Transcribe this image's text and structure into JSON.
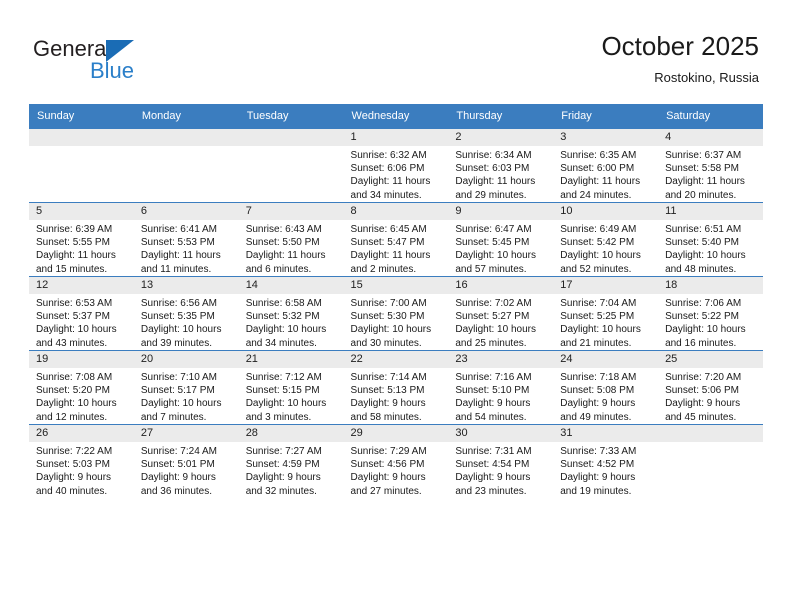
{
  "logo": {
    "word_one": "General",
    "word_two": "Blue",
    "triangle_icon": "blue-triangle-icon",
    "accent_dark": "#231f20",
    "accent_blue": "#2a7fc9"
  },
  "header": {
    "title": "October 2025",
    "subtitle": "Rostokino, Russia"
  },
  "theme": {
    "header_row_bg": "#3b7dbf",
    "cell_head_bg": "#ebebeb",
    "text": "#1a1a1a"
  },
  "weekday_headers": [
    "Sunday",
    "Monday",
    "Tuesday",
    "Wednesday",
    "Thursday",
    "Friday",
    "Saturday"
  ],
  "weeks": [
    [
      {
        "day": "",
        "sunrise": "",
        "sunset": "",
        "daylight_line1": "",
        "daylight_line2": "",
        "empty": true
      },
      {
        "day": "",
        "sunrise": "",
        "sunset": "",
        "daylight_line1": "",
        "daylight_line2": "",
        "empty": true
      },
      {
        "day": "",
        "sunrise": "",
        "sunset": "",
        "daylight_line1": "",
        "daylight_line2": "",
        "empty": true
      },
      {
        "day": "1",
        "sunrise": "Sunrise: 6:32 AM",
        "sunset": "Sunset: 6:06 PM",
        "daylight_line1": "Daylight: 11 hours",
        "daylight_line2": "and 34 minutes.",
        "empty": false
      },
      {
        "day": "2",
        "sunrise": "Sunrise: 6:34 AM",
        "sunset": "Sunset: 6:03 PM",
        "daylight_line1": "Daylight: 11 hours",
        "daylight_line2": "and 29 minutes.",
        "empty": false
      },
      {
        "day": "3",
        "sunrise": "Sunrise: 6:35 AM",
        "sunset": "Sunset: 6:00 PM",
        "daylight_line1": "Daylight: 11 hours",
        "daylight_line2": "and 24 minutes.",
        "empty": false
      },
      {
        "day": "4",
        "sunrise": "Sunrise: 6:37 AM",
        "sunset": "Sunset: 5:58 PM",
        "daylight_line1": "Daylight: 11 hours",
        "daylight_line2": "and 20 minutes.",
        "empty": false
      }
    ],
    [
      {
        "day": "5",
        "sunrise": "Sunrise: 6:39 AM",
        "sunset": "Sunset: 5:55 PM",
        "daylight_line1": "Daylight: 11 hours",
        "daylight_line2": "and 15 minutes.",
        "empty": false
      },
      {
        "day": "6",
        "sunrise": "Sunrise: 6:41 AM",
        "sunset": "Sunset: 5:53 PM",
        "daylight_line1": "Daylight: 11 hours",
        "daylight_line2": "and 11 minutes.",
        "empty": false
      },
      {
        "day": "7",
        "sunrise": "Sunrise: 6:43 AM",
        "sunset": "Sunset: 5:50 PM",
        "daylight_line1": "Daylight: 11 hours",
        "daylight_line2": "and 6 minutes.",
        "empty": false
      },
      {
        "day": "8",
        "sunrise": "Sunrise: 6:45 AM",
        "sunset": "Sunset: 5:47 PM",
        "daylight_line1": "Daylight: 11 hours",
        "daylight_line2": "and 2 minutes.",
        "empty": false
      },
      {
        "day": "9",
        "sunrise": "Sunrise: 6:47 AM",
        "sunset": "Sunset: 5:45 PM",
        "daylight_line1": "Daylight: 10 hours",
        "daylight_line2": "and 57 minutes.",
        "empty": false
      },
      {
        "day": "10",
        "sunrise": "Sunrise: 6:49 AM",
        "sunset": "Sunset: 5:42 PM",
        "daylight_line1": "Daylight: 10 hours",
        "daylight_line2": "and 52 minutes.",
        "empty": false
      },
      {
        "day": "11",
        "sunrise": "Sunrise: 6:51 AM",
        "sunset": "Sunset: 5:40 PM",
        "daylight_line1": "Daylight: 10 hours",
        "daylight_line2": "and 48 minutes.",
        "empty": false
      }
    ],
    [
      {
        "day": "12",
        "sunrise": "Sunrise: 6:53 AM",
        "sunset": "Sunset: 5:37 PM",
        "daylight_line1": "Daylight: 10 hours",
        "daylight_line2": "and 43 minutes.",
        "empty": false
      },
      {
        "day": "13",
        "sunrise": "Sunrise: 6:56 AM",
        "sunset": "Sunset: 5:35 PM",
        "daylight_line1": "Daylight: 10 hours",
        "daylight_line2": "and 39 minutes.",
        "empty": false
      },
      {
        "day": "14",
        "sunrise": "Sunrise: 6:58 AM",
        "sunset": "Sunset: 5:32 PM",
        "daylight_line1": "Daylight: 10 hours",
        "daylight_line2": "and 34 minutes.",
        "empty": false
      },
      {
        "day": "15",
        "sunrise": "Sunrise: 7:00 AM",
        "sunset": "Sunset: 5:30 PM",
        "daylight_line1": "Daylight: 10 hours",
        "daylight_line2": "and 30 minutes.",
        "empty": false
      },
      {
        "day": "16",
        "sunrise": "Sunrise: 7:02 AM",
        "sunset": "Sunset: 5:27 PM",
        "daylight_line1": "Daylight: 10 hours",
        "daylight_line2": "and 25 minutes.",
        "empty": false
      },
      {
        "day": "17",
        "sunrise": "Sunrise: 7:04 AM",
        "sunset": "Sunset: 5:25 PM",
        "daylight_line1": "Daylight: 10 hours",
        "daylight_line2": "and 21 minutes.",
        "empty": false
      },
      {
        "day": "18",
        "sunrise": "Sunrise: 7:06 AM",
        "sunset": "Sunset: 5:22 PM",
        "daylight_line1": "Daylight: 10 hours",
        "daylight_line2": "and 16 minutes.",
        "empty": false
      }
    ],
    [
      {
        "day": "19",
        "sunrise": "Sunrise: 7:08 AM",
        "sunset": "Sunset: 5:20 PM",
        "daylight_line1": "Daylight: 10 hours",
        "daylight_line2": "and 12 minutes.",
        "empty": false
      },
      {
        "day": "20",
        "sunrise": "Sunrise: 7:10 AM",
        "sunset": "Sunset: 5:17 PM",
        "daylight_line1": "Daylight: 10 hours",
        "daylight_line2": "and 7 minutes.",
        "empty": false
      },
      {
        "day": "21",
        "sunrise": "Sunrise: 7:12 AM",
        "sunset": "Sunset: 5:15 PM",
        "daylight_line1": "Daylight: 10 hours",
        "daylight_line2": "and 3 minutes.",
        "empty": false
      },
      {
        "day": "22",
        "sunrise": "Sunrise: 7:14 AM",
        "sunset": "Sunset: 5:13 PM",
        "daylight_line1": "Daylight: 9 hours",
        "daylight_line2": "and 58 minutes.",
        "empty": false
      },
      {
        "day": "23",
        "sunrise": "Sunrise: 7:16 AM",
        "sunset": "Sunset: 5:10 PM",
        "daylight_line1": "Daylight: 9 hours",
        "daylight_line2": "and 54 minutes.",
        "empty": false
      },
      {
        "day": "24",
        "sunrise": "Sunrise: 7:18 AM",
        "sunset": "Sunset: 5:08 PM",
        "daylight_line1": "Daylight: 9 hours",
        "daylight_line2": "and 49 minutes.",
        "empty": false
      },
      {
        "day": "25",
        "sunrise": "Sunrise: 7:20 AM",
        "sunset": "Sunset: 5:06 PM",
        "daylight_line1": "Daylight: 9 hours",
        "daylight_line2": "and 45 minutes.",
        "empty": false
      }
    ],
    [
      {
        "day": "26",
        "sunrise": "Sunrise: 7:22 AM",
        "sunset": "Sunset: 5:03 PM",
        "daylight_line1": "Daylight: 9 hours",
        "daylight_line2": "and 40 minutes.",
        "empty": false
      },
      {
        "day": "27",
        "sunrise": "Sunrise: 7:24 AM",
        "sunset": "Sunset: 5:01 PM",
        "daylight_line1": "Daylight: 9 hours",
        "daylight_line2": "and 36 minutes.",
        "empty": false
      },
      {
        "day": "28",
        "sunrise": "Sunrise: 7:27 AM",
        "sunset": "Sunset: 4:59 PM",
        "daylight_line1": "Daylight: 9 hours",
        "daylight_line2": "and 32 minutes.",
        "empty": false
      },
      {
        "day": "29",
        "sunrise": "Sunrise: 7:29 AM",
        "sunset": "Sunset: 4:56 PM",
        "daylight_line1": "Daylight: 9 hours",
        "daylight_line2": "and 27 minutes.",
        "empty": false
      },
      {
        "day": "30",
        "sunrise": "Sunrise: 7:31 AM",
        "sunset": "Sunset: 4:54 PM",
        "daylight_line1": "Daylight: 9 hours",
        "daylight_line2": "and 23 minutes.",
        "empty": false
      },
      {
        "day": "31",
        "sunrise": "Sunrise: 7:33 AM",
        "sunset": "Sunset: 4:52 PM",
        "daylight_line1": "Daylight: 9 hours",
        "daylight_line2": "and 19 minutes.",
        "empty": false
      },
      {
        "day": "",
        "sunrise": "",
        "sunset": "",
        "daylight_line1": "",
        "daylight_line2": "",
        "empty": true
      }
    ]
  ]
}
